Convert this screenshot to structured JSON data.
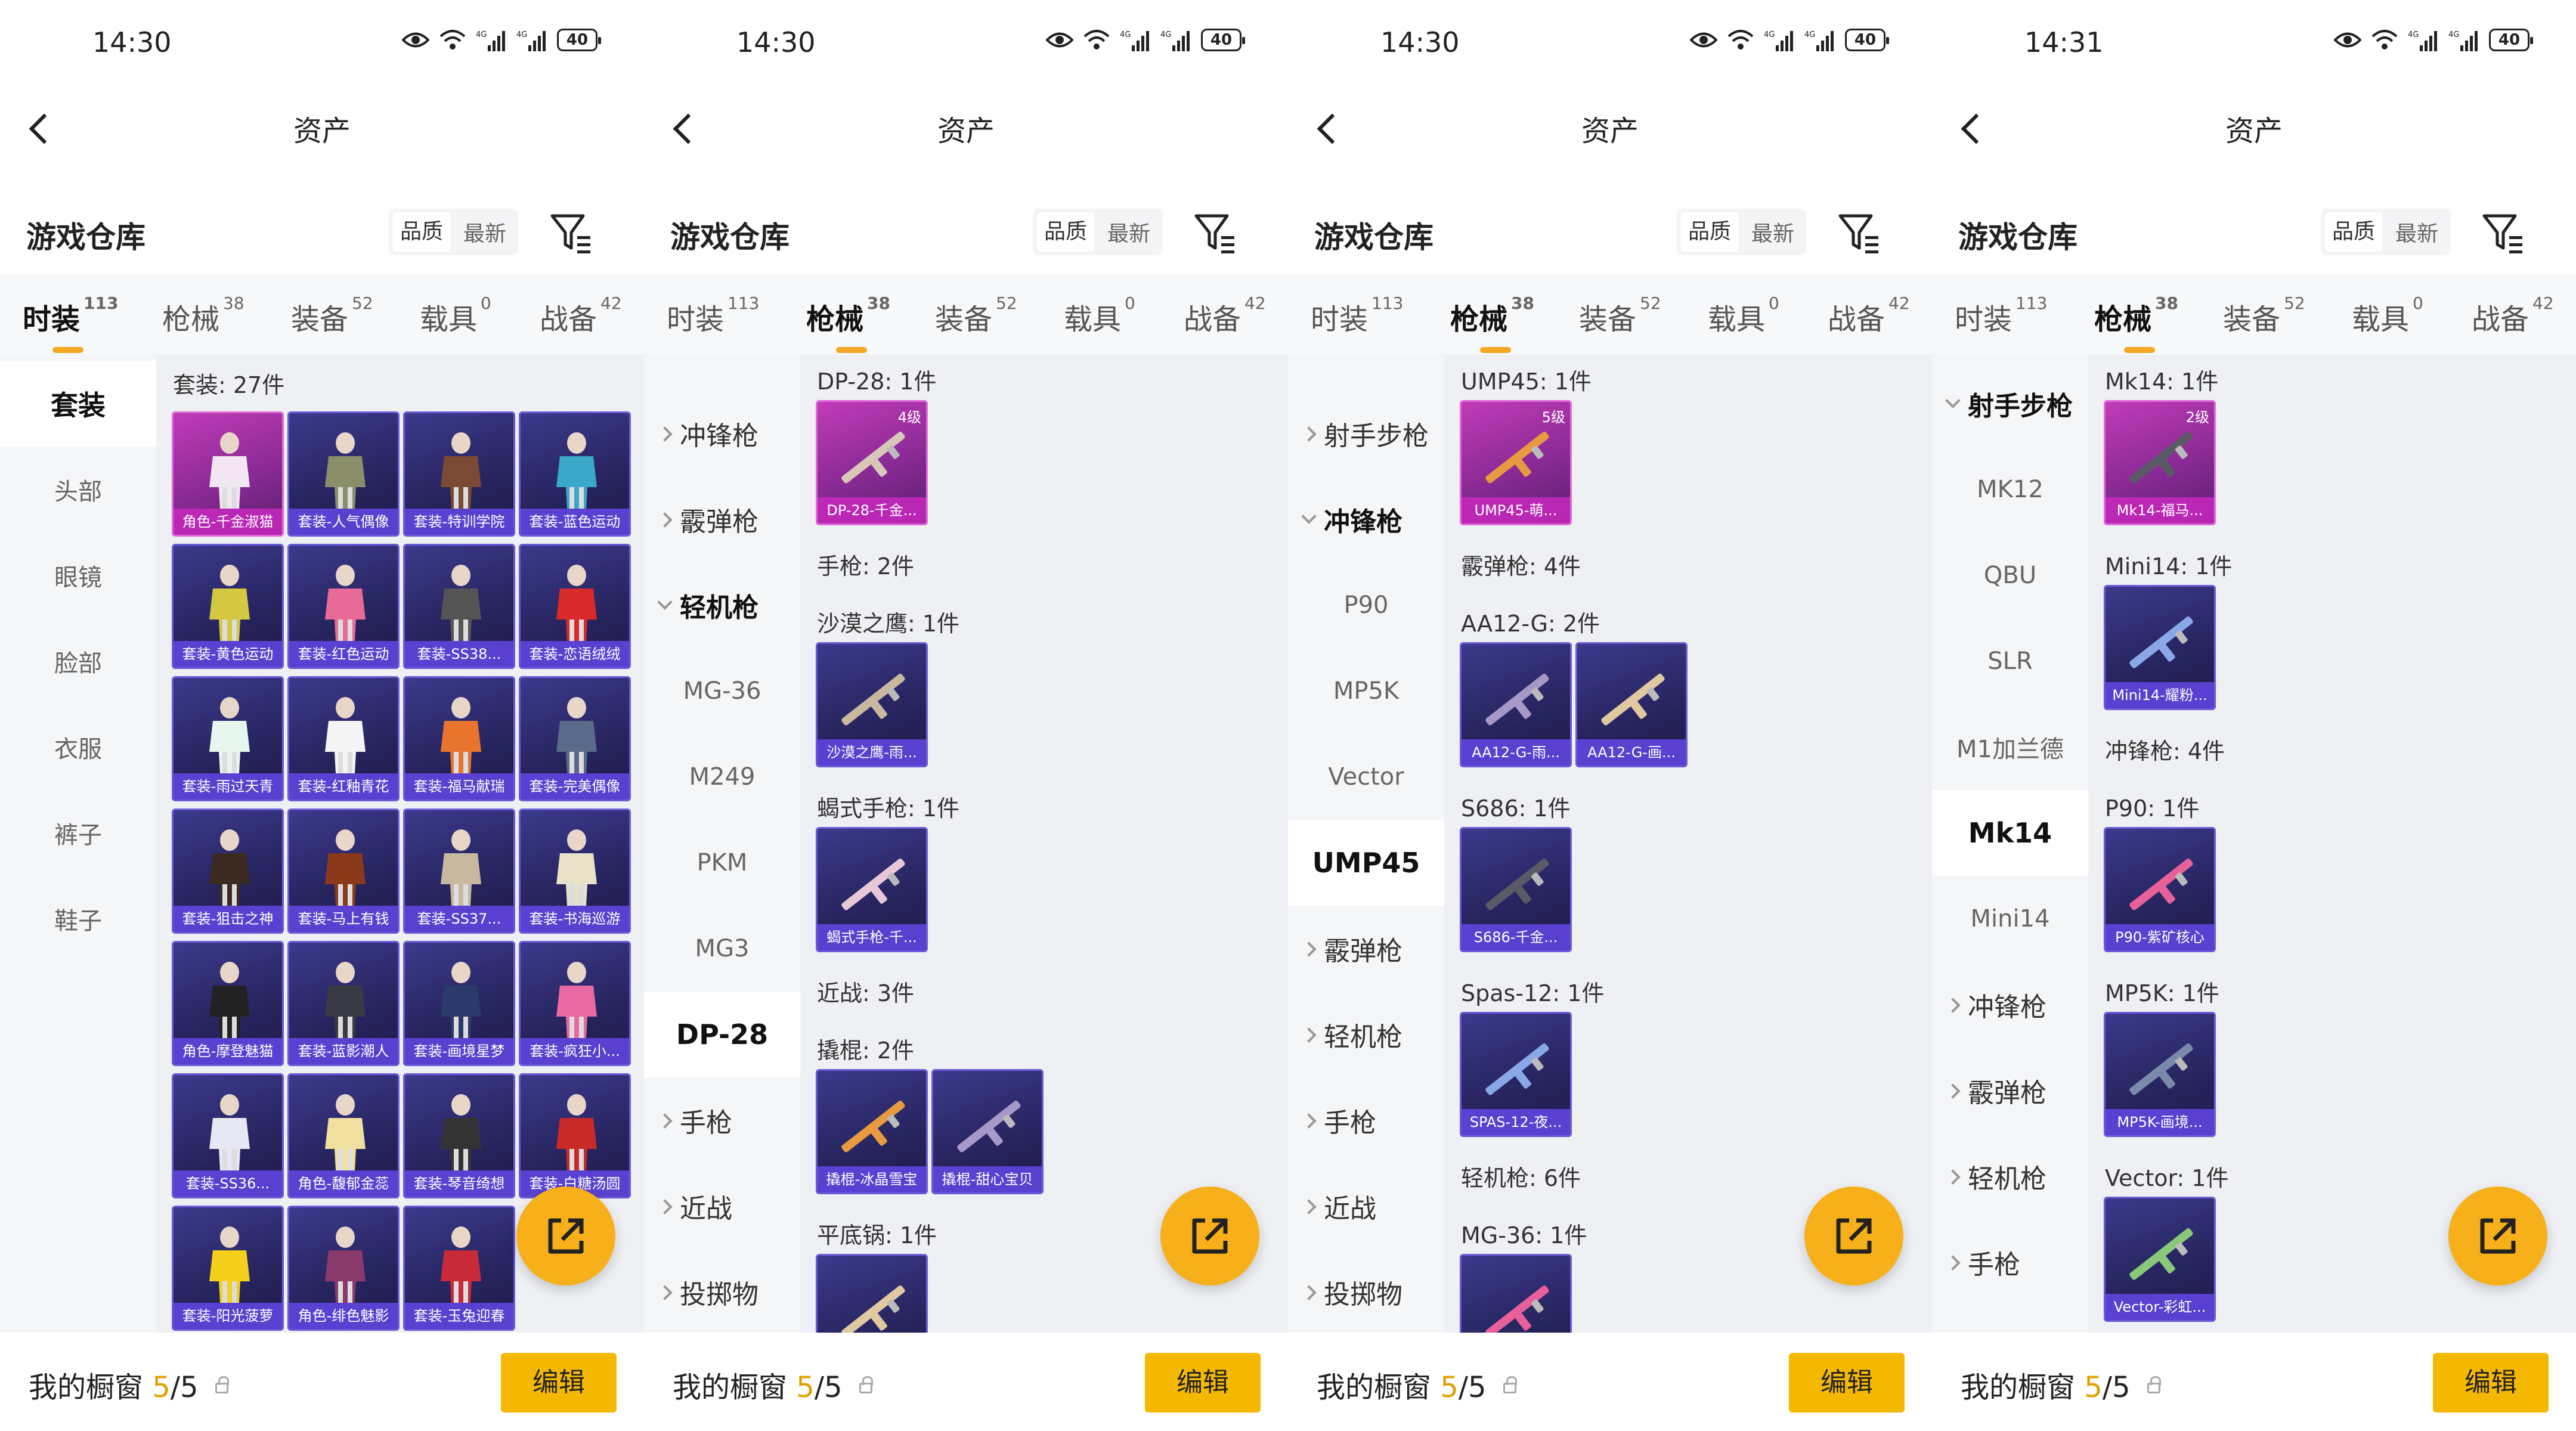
{
  "panels": [
    {
      "time": "14:30",
      "title": "资产",
      "section": "游戏仓库",
      "sort1": "品质",
      "sort2": "最新",
      "tabs": [
        {
          "label": "时装",
          "count": "113"
        },
        {
          "label": "枪械",
          "count": "38"
        },
        {
          "label": "装备",
          "count": "52"
        },
        {
          "label": "载具",
          "count": "0"
        },
        {
          "label": "战备",
          "count": "42"
        }
      ],
      "active_tab": 0,
      "nav": [
        {
          "label": "套装",
          "state": "sel"
        },
        {
          "label": "头部"
        },
        {
          "label": "眼镜"
        },
        {
          "label": "脸部"
        },
        {
          "label": "衣服"
        },
        {
          "label": "裤子"
        },
        {
          "label": "鞋子"
        }
      ],
      "sections": [
        {
          "label": "套装: 27件",
          "items": [
            {
              "name": "角色-千金淑猫",
              "pink": true
            },
            {
              "name": "套装-人气偶像"
            },
            {
              "name": "套装-特训学院"
            },
            {
              "name": "套装-蓝色运动"
            },
            {
              "name": "套装-黄色运动"
            },
            {
              "name": "套装-红色运动"
            },
            {
              "name": "套装-SS38..."
            },
            {
              "name": "套装-恋语绒绒"
            },
            {
              "name": "套装-雨过天青"
            },
            {
              "name": "套装-红釉青花"
            },
            {
              "name": "套装-福马献瑞"
            },
            {
              "name": "套装-完美偶像"
            },
            {
              "name": "套装-狙击之神"
            },
            {
              "name": "套装-马上有钱"
            },
            {
              "name": "套装-SS37..."
            },
            {
              "name": "套装-书海巡游"
            },
            {
              "name": "角色-摩登魅猫"
            },
            {
              "name": "套装-蓝影潮人"
            },
            {
              "name": "套装-画境星梦"
            },
            {
              "name": "套装-疯狂小..."
            },
            {
              "name": "套装-SS36..."
            },
            {
              "name": "角色-馥郁金蕊"
            },
            {
              "name": "套装-琴音绮想"
            },
            {
              "name": "套装-白糖汤圆"
            },
            {
              "name": "套装-阳光菠萝"
            },
            {
              "name": "角色-绯色魅影"
            },
            {
              "name": "套装-玉兔迎春"
            }
          ]
        }
      ],
      "footer": {
        "label": "我的橱窗",
        "num": "5",
        "total": "/5",
        "edit": "编辑"
      }
    },
    {
      "time": "14:30",
      "title": "资产",
      "section": "游戏仓库",
      "sort1": "品质",
      "sort2": "最新",
      "tabs": [
        {
          "label": "时装",
          "count": "113"
        },
        {
          "label": "枪械",
          "count": "38"
        },
        {
          "label": "装备",
          "count": "52"
        },
        {
          "label": "载具",
          "count": "0"
        },
        {
          "label": "战备",
          "count": "42"
        }
      ],
      "active_tab": 1,
      "nav": [
        {
          "label": "冲锋枪",
          "state": "grp"
        },
        {
          "label": "霰弹枪",
          "state": "grp"
        },
        {
          "label": "轻机枪",
          "state": "open"
        },
        {
          "label": "MG-36"
        },
        {
          "label": "M249"
        },
        {
          "label": "PKM"
        },
        {
          "label": "MG3"
        },
        {
          "label": "DP-28",
          "state": "sel"
        },
        {
          "label": "手枪",
          "state": "grp"
        },
        {
          "label": "近战",
          "state": "grp"
        },
        {
          "label": "投掷物",
          "state": "grp"
        }
      ],
      "sections": [
        {
          "label": "DP-28: 1件",
          "items": [
            {
              "name": "DP-28-千金...",
              "pink": true,
              "lvl": "4级"
            }
          ]
        },
        {
          "label": "手枪: 2件",
          "items": []
        },
        {
          "label": "沙漠之鹰: 1件",
          "items": [
            {
              "name": "沙漠之鹰-雨..."
            }
          ]
        },
        {
          "label": "蝎式手枪: 1件",
          "items": [
            {
              "name": "蝎式手枪-千..."
            }
          ]
        },
        {
          "label": "近战: 3件",
          "items": []
        },
        {
          "label": "撬棍: 2件",
          "items": [
            {
              "name": "撬棍-冰晶雪宝"
            },
            {
              "name": "撬棍-甜心宝贝"
            }
          ]
        },
        {
          "label": "平底锅: 1件",
          "items": [
            {
              "name": ""
            }
          ]
        }
      ],
      "footer": {
        "label": "我的橱窗",
        "num": "5",
        "total": "/5",
        "edit": "编辑"
      }
    },
    {
      "time": "14:30",
      "title": "资产",
      "section": "游戏仓库",
      "sort1": "品质",
      "sort2": "最新",
      "tabs": [
        {
          "label": "时装",
          "count": "113"
        },
        {
          "label": "枪械",
          "count": "38"
        },
        {
          "label": "装备",
          "count": "52"
        },
        {
          "label": "载具",
          "count": "0"
        },
        {
          "label": "战备",
          "count": "42"
        }
      ],
      "active_tab": 1,
      "nav": [
        {
          "label": "射手步枪",
          "state": "grp"
        },
        {
          "label": "冲锋枪",
          "state": "open"
        },
        {
          "label": "P90"
        },
        {
          "label": "MP5K"
        },
        {
          "label": "Vector"
        },
        {
          "label": "UMP45",
          "state": "sel"
        },
        {
          "label": "霰弹枪",
          "state": "grp"
        },
        {
          "label": "轻机枪",
          "state": "grp"
        },
        {
          "label": "手枪",
          "state": "grp"
        },
        {
          "label": "近战",
          "state": "grp"
        },
        {
          "label": "投掷物",
          "state": "grp"
        }
      ],
      "sections": [
        {
          "label": "UMP45: 1件",
          "items": [
            {
              "name": "UMP45-萌...",
              "pink": true,
              "lvl": "5级"
            }
          ]
        },
        {
          "label": "霰弹枪: 4件",
          "items": []
        },
        {
          "label": "AA12-G: 2件",
          "items": [
            {
              "name": "AA12-G-雨..."
            },
            {
              "name": "AA12-G-画..."
            }
          ]
        },
        {
          "label": "S686: 1件",
          "items": [
            {
              "name": "S686-千金..."
            }
          ]
        },
        {
          "label": "Spas-12: 1件",
          "items": [
            {
              "name": "SPAS-12-夜..."
            }
          ]
        },
        {
          "label": "轻机枪: 6件",
          "items": []
        },
        {
          "label": "MG-36: 1件",
          "items": [
            {
              "name": ""
            }
          ]
        }
      ],
      "footer": {
        "label": "我的橱窗",
        "num": "5",
        "total": "/5",
        "edit": "编辑"
      }
    },
    {
      "time": "14:31",
      "title": "资产",
      "section": "游戏仓库",
      "sort1": "品质",
      "sort2": "最新",
      "tabs": [
        {
          "label": "时装",
          "count": "113"
        },
        {
          "label": "枪械",
          "count": "38"
        },
        {
          "label": "装备",
          "count": "52"
        },
        {
          "label": "载具",
          "count": "0"
        },
        {
          "label": "战备",
          "count": "42"
        }
      ],
      "active_tab": 1,
      "nav": [
        {
          "label": "射手步枪",
          "state": "open"
        },
        {
          "label": "MK12"
        },
        {
          "label": "QBU"
        },
        {
          "label": "SLR"
        },
        {
          "label": "M1加兰德"
        },
        {
          "label": "Mk14",
          "state": "sel"
        },
        {
          "label": "Mini14"
        },
        {
          "label": "冲锋枪",
          "state": "grp"
        },
        {
          "label": "霰弹枪",
          "state": "grp"
        },
        {
          "label": "轻机枪",
          "state": "grp"
        },
        {
          "label": "手枪",
          "state": "grp"
        }
      ],
      "sections": [
        {
          "label": "Mk14: 1件",
          "items": [
            {
              "name": "Mk14-福马...",
              "pink": true,
              "lvl": "2级"
            }
          ]
        },
        {
          "label": "Mini14: 1件",
          "items": [
            {
              "name": "Mini14-耀粉..."
            }
          ]
        },
        {
          "label": "冲锋枪: 4件",
          "items": []
        },
        {
          "label": "P90: 1件",
          "items": [
            {
              "name": "P90-紫矿核心"
            }
          ]
        },
        {
          "label": "MP5K: 1件",
          "items": [
            {
              "name": "MP5K-画境..."
            }
          ]
        },
        {
          "label": "Vector: 1件",
          "items": [
            {
              "name": "Vector-彩虹..."
            }
          ]
        }
      ],
      "footer": {
        "label": "我的橱窗",
        "num": "5",
        "total": "/5",
        "edit": "编辑"
      }
    }
  ]
}
